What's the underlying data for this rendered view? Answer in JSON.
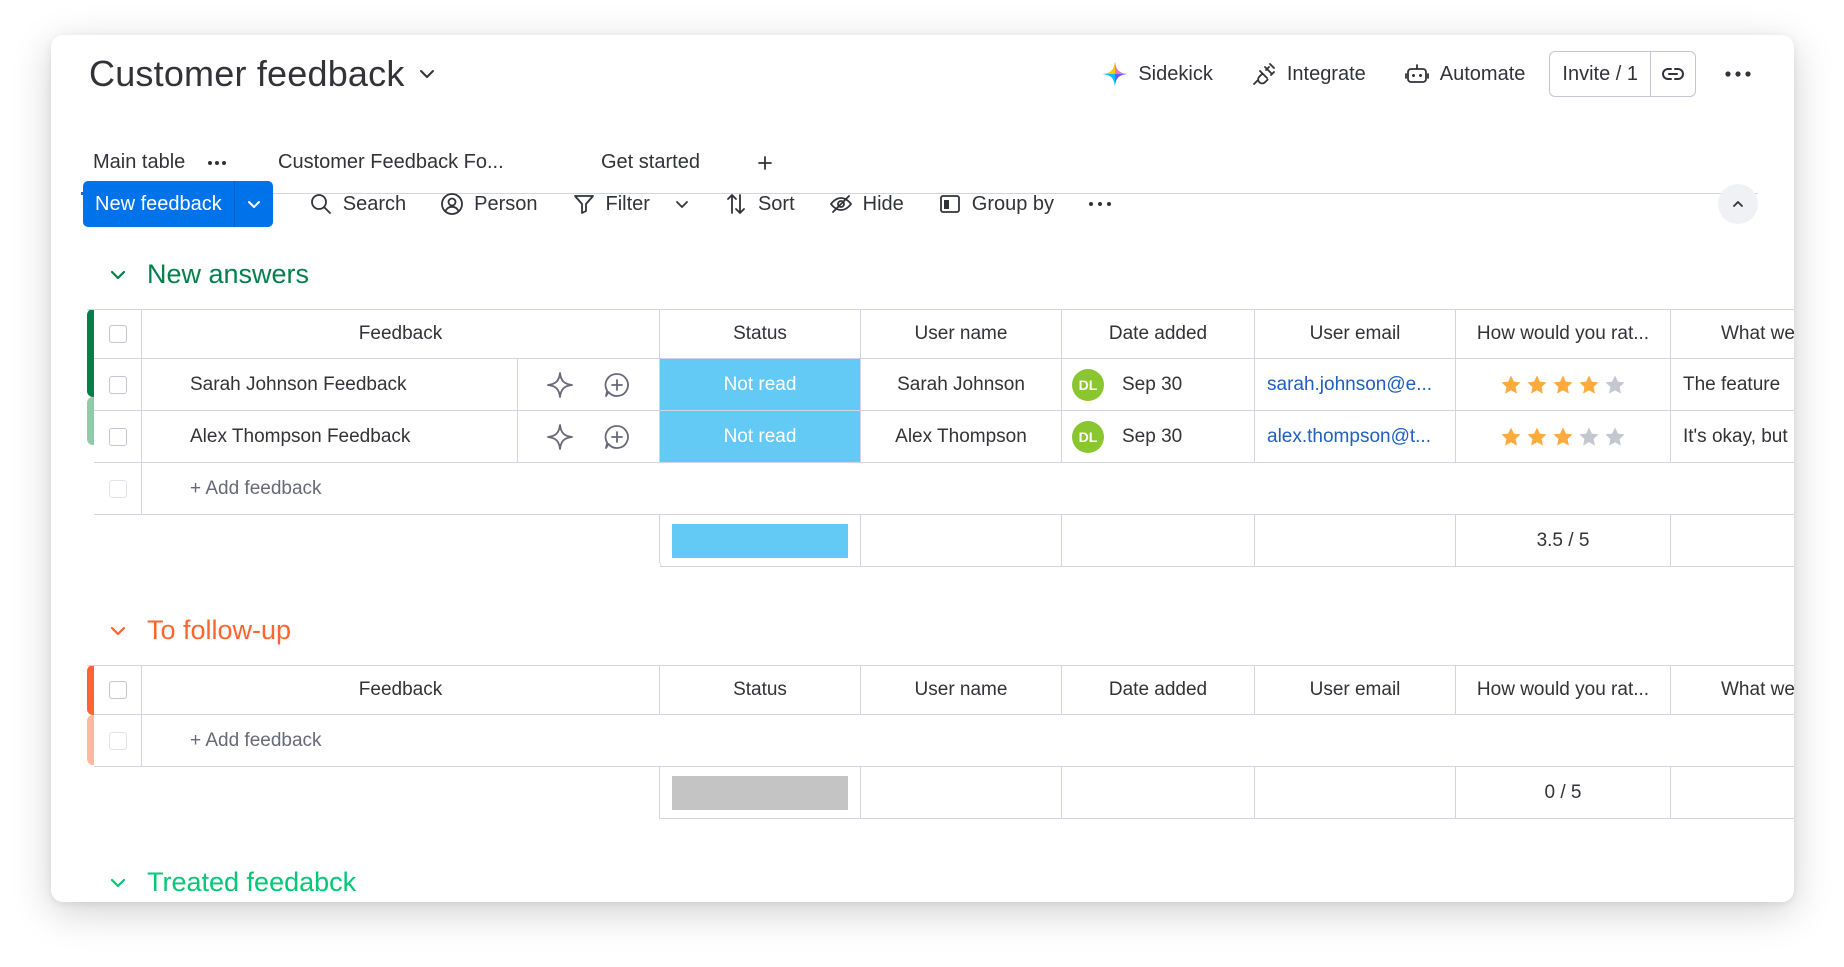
{
  "board": {
    "title": "Customer feedback"
  },
  "top_actions": {
    "sidekick": "Sidekick",
    "integrate": "Integrate",
    "automate": "Automate",
    "invite": "Invite / 1"
  },
  "tabs": [
    {
      "label": "Main table"
    },
    {
      "label": "Customer Feedback Fo..."
    },
    {
      "label": "Get started"
    }
  ],
  "toolbar": {
    "new_item": "New feedback",
    "search": "Search",
    "person": "Person",
    "filter": "Filter",
    "sort": "Sort",
    "hide": "Hide",
    "group_by": "Group by"
  },
  "columns": [
    "Feedback",
    "Status",
    "User name",
    "Date added",
    "User email",
    "How would you rat...",
    "What we"
  ],
  "groups": [
    {
      "title": "New answers",
      "color": "#037f4c",
      "add_label": "+ Add feedback",
      "rows": [
        {
          "name": "Sarah Johnson Feedback",
          "status": "Not read",
          "user": "Sarah Johnson",
          "initials": "DL",
          "date": "Sep 30",
          "email": "sarah.johnson@e...",
          "rating": 4,
          "what": "The feature"
        },
        {
          "name": "Alex Thompson Feedback",
          "status": "Not read",
          "user": "Alex Thompson",
          "initials": "DL",
          "date": "Sep 30",
          "email": "alex.thompson@t...",
          "rating": 3,
          "what": "It's okay, but"
        }
      ],
      "summary": {
        "status_color": "#63c9f5",
        "rating": "3.5 / 5"
      }
    },
    {
      "title": "To follow-up",
      "color": "#ff642e",
      "add_label": "+ Add feedback",
      "rows": [],
      "summary": {
        "status_color": "#c4c4c4",
        "rating": "0 / 5"
      }
    },
    {
      "title": "Treated feedabck",
      "color": "#00c875"
    }
  ],
  "colors": {
    "primary": "#0073ea",
    "status_not_read": "#63c9f5",
    "star_on": "#fdab3d",
    "star_off": "#c5c7d0",
    "avatar": "#8ac630"
  }
}
